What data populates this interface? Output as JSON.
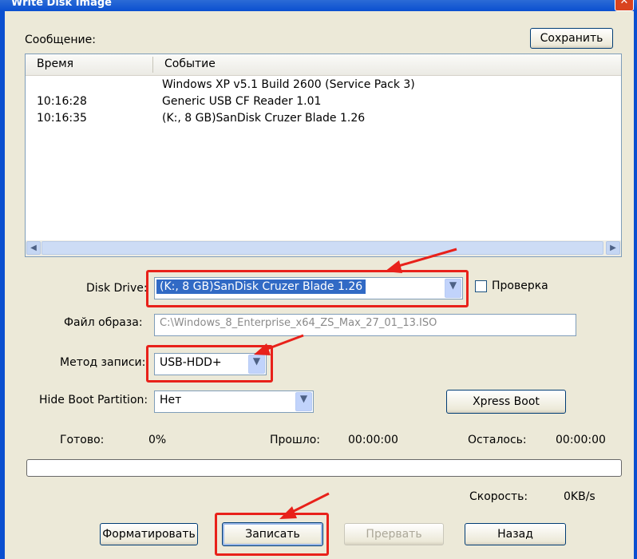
{
  "window": {
    "title": "Write Disk Image",
    "close_label": "✕"
  },
  "message_section": {
    "label": "Сообщение:",
    "save_button": "Сохранить"
  },
  "log": {
    "columns": [
      "Время",
      "Событие"
    ],
    "rows": [
      {
        "time": "",
        "event": "Windows XP v5.1 Build 2600 (Service Pack 3)"
      },
      {
        "time": "10:16:28",
        "event": "Generic USB CF Reader   1.01"
      },
      {
        "time": "10:16:35",
        "event": "(K:, 8 GB)SanDisk Cruzer Blade   1.26"
      }
    ]
  },
  "form": {
    "disk_drive": {
      "label": "Disk Drive:",
      "value": "(K:, 8 GB)SanDisk Cruzer Blade     1.26"
    },
    "verify": {
      "label": "Проверка",
      "checked": false
    },
    "image_file": {
      "label": "Файл образа:",
      "value": "C:\\Windows_8_Enterprise_x64_ZS_Max_27_01_13.ISO"
    },
    "write_method": {
      "label": "Метод записи:",
      "value": "USB-HDD+"
    },
    "hide_boot": {
      "label": "Hide Boot Partition:",
      "value": "Нет"
    },
    "xpress_boot_button": "Xpress Boot"
  },
  "status": {
    "done_label": "Готово:",
    "done_value": "0%",
    "elapsed_label": "Прошло:",
    "elapsed_value": "00:00:00",
    "remaining_label": "Осталось:",
    "remaining_value": "00:00:00",
    "speed_label": "Скорость:",
    "speed_value": "0KB/s",
    "progress": 0
  },
  "buttons": {
    "format": "Форматировать",
    "write": "Записать",
    "abort": "Прервать",
    "back": "Назад"
  },
  "colors": {
    "highlight_red": "#e8211a",
    "selection_blue": "#316ac5",
    "xp_title_blue": "#0a4fd0"
  },
  "icons": [
    "close-icon",
    "scroll-left-icon",
    "scroll-right-icon",
    "chevron-down-icon"
  ]
}
